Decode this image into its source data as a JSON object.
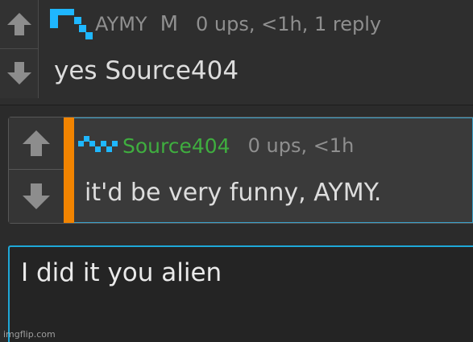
{
  "comment": {
    "username": "AYMY",
    "mod_badge": "M",
    "meta": "0 ups, <1h, 1 reply",
    "text": "yes Source404"
  },
  "reply": {
    "username": "Source404",
    "meta": "0 ups, <1h",
    "text": "it'd be very funny, AYMY."
  },
  "composer": {
    "value": "I did it you alien"
  },
  "watermark": "imgflip.com",
  "icons": {
    "upvote": "arrow-up-icon",
    "downvote": "arrow-down-icon",
    "avatar": "avatar-icon"
  },
  "colors": {
    "accent_blue": "#1ea8d8",
    "reply_stripe": "#f28400",
    "reply_username": "#3fae3f",
    "avatar_cyan": "#1fb7ff"
  }
}
